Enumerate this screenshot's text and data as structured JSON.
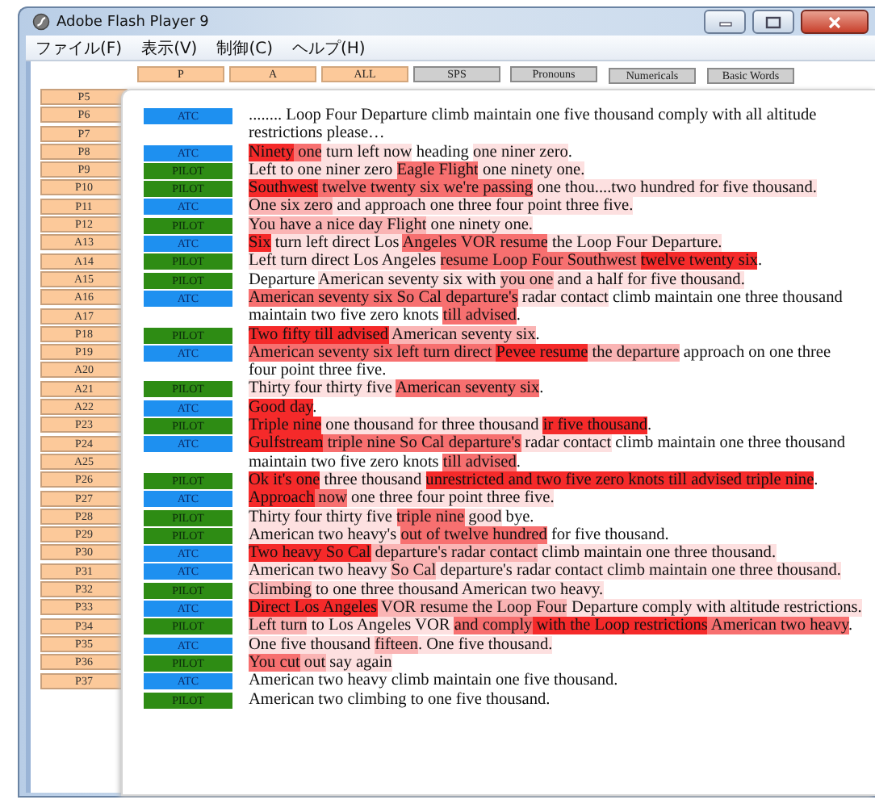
{
  "window": {
    "title": "Adobe Flash Player 9"
  },
  "menu": [
    "ファイル(F)",
    "表示(V)",
    "制御(C)",
    "ヘルプ(H)"
  ],
  "filters": [
    {
      "label": "P",
      "kind": "speaker"
    },
    {
      "label": "A",
      "kind": "speaker"
    },
    {
      "label": "ALL",
      "kind": "speaker"
    },
    {
      "label": "SPS",
      "kind": "category"
    },
    {
      "label": "Pronouns",
      "kind": "category"
    },
    {
      "label": "Numericals",
      "kind": "category"
    },
    {
      "label": "Basic Words",
      "kind": "category"
    }
  ],
  "turns": [
    "P5",
    "P6",
    "P7",
    "P8",
    "P9",
    "P10",
    "P11",
    "P12",
    "A13",
    "A14",
    "A15",
    "A16",
    "A17",
    "P18",
    "P19",
    "A20",
    "A21",
    "A22",
    "P23",
    "P24",
    "A25",
    "P26",
    "P27",
    "P28",
    "P29",
    "P30",
    "P31",
    "P32",
    "P33",
    "P34",
    "P35",
    "P36",
    "P37"
  ],
  "transcript": [
    {
      "speaker": "ATC",
      "kind": "atc",
      "segments": [
        {
          "text": "........ Loop Four Departure climb maintain one five thousand comply with all altitude restrictions please…"
        }
      ]
    },
    {
      "speaker": "ATC",
      "kind": "atc",
      "segments": [
        {
          "text": "Ninety",
          "color": "#f52a2a"
        },
        {
          "text": " one",
          "color": "#f77070"
        },
        {
          "text": " turn left now",
          "color": "#fde0e0"
        },
        {
          "text": " heading "
        },
        {
          "text": "one niner zero",
          "color": "#fde0e0"
        },
        {
          "text": "."
        }
      ]
    },
    {
      "speaker": "PILOT",
      "kind": "pilot",
      "segments": [
        {
          "text": "Left to one niner zero ",
          "color": "#fde0e0"
        },
        {
          "text": "Eagle Flight",
          "color": "#f77070"
        },
        {
          "text": " one ninety one.",
          "color": "#fde0e0"
        }
      ]
    },
    {
      "speaker": "PILOT",
      "kind": "pilot",
      "segments": [
        {
          "text": "Southwest",
          "color": "#f52a2a"
        },
        {
          "text": " twelve twenty six we're passing",
          "color": "#f77070"
        },
        {
          "text": " one thou....two hundred for five thousand.",
          "color": "#fde0e0"
        }
      ]
    },
    {
      "speaker": "ATC",
      "kind": "atc",
      "segments": [
        {
          "text": "One six zero",
          "color": "#fab4b4"
        },
        {
          "text": " and approach one three four point three five.",
          "color": "#fde0e0"
        }
      ]
    },
    {
      "speaker": "PILOT",
      "kind": "pilot",
      "segments": [
        {
          "text": "You have a nice day Flight",
          "color": "#fab4b4"
        },
        {
          "text": " one ninety one.",
          "color": "#fde0e0"
        }
      ]
    },
    {
      "speaker": "ATC",
      "kind": "atc",
      "segments": [
        {
          "text": "Six",
          "color": "#f52a2a"
        },
        {
          "text": " turn left direct Los ",
          "color": "#fde0e0"
        },
        {
          "text": "Angeles VOR resume",
          "color": "#f77070"
        },
        {
          "text": " the Loop Four Departure.",
          "color": "#fde0e0"
        }
      ]
    },
    {
      "speaker": "PILOT",
      "kind": "pilot",
      "segments": [
        {
          "text": "Left turn direct Los Angeles ",
          "color": "#fde0e0"
        },
        {
          "text": "resume Loop Four Southwest ",
          "color": "#f77070"
        },
        {
          "text": "twelve twenty six",
          "color": "#f52a2a"
        },
        {
          "text": "."
        }
      ]
    },
    {
      "speaker": "PILOT",
      "kind": "pilot",
      "segments": [
        {
          "text": "Departure "
        },
        {
          "text": "American seventy six with ",
          "color": "#fde0e0"
        },
        {
          "text": "you one",
          "color": "#fab4b4"
        },
        {
          "text": " and a half for five thousand.",
          "color": "#fde0e0"
        }
      ]
    },
    {
      "speaker": "ATC",
      "kind": "atc",
      "segments": [
        {
          "text": "American seventy six So Cal departure's",
          "color": "#f77070"
        },
        {
          "text": " radar contact",
          "color": "#fde0e0"
        },
        {
          "text": " climb maintain one three thousand maintain two five zero knots "
        },
        {
          "text": "till advised",
          "color": "#f77070"
        },
        {
          "text": "."
        }
      ]
    },
    {
      "speaker": "PILOT",
      "kind": "pilot",
      "segments": [
        {
          "text": "Two fifty till advised",
          "color": "#f52a2a"
        },
        {
          "text": " American seventy six",
          "color": "#fab4b4"
        },
        {
          "text": "."
        }
      ]
    },
    {
      "speaker": "ATC",
      "kind": "atc",
      "segments": [
        {
          "text": "American seventy six left turn direct ",
          "color": "#f77070"
        },
        {
          "text": "Pevee resume",
          "color": "#f52a2a"
        },
        {
          "text": " the departure",
          "color": "#fab4b4"
        },
        {
          "text": " approach on one three four point three five."
        }
      ]
    },
    {
      "speaker": "PILOT",
      "kind": "pilot",
      "segments": [
        {
          "text": "Thirty four thirty five ",
          "color": "#fde0e0"
        },
        {
          "text": "American seventy six",
          "color": "#f77070"
        },
        {
          "text": "."
        }
      ]
    },
    {
      "speaker": "ATC",
      "kind": "atc",
      "segments": [
        {
          "text": "Good day",
          "color": "#f52a2a"
        },
        {
          "text": "."
        }
      ]
    },
    {
      "speaker": "PILOT",
      "kind": "pilot",
      "segments": [
        {
          "text": "Triple nine",
          "color": "#f52a2a"
        },
        {
          "text": " one thousand for three thousand ",
          "color": "#fde0e0"
        },
        {
          "text": "ir five thousand",
          "color": "#f52a2a"
        },
        {
          "text": "."
        }
      ]
    },
    {
      "speaker": "ATC",
      "kind": "atc",
      "segments": [
        {
          "text": "Gulfstream",
          "color": "#f52a2a"
        },
        {
          "text": " triple nine So Cal departure's",
          "color": "#f77070"
        },
        {
          "text": " radar contact",
          "color": "#fde0e0"
        },
        {
          "text": " climb maintain one three thousand maintain two five zero knots "
        },
        {
          "text": "till advised",
          "color": "#f77070"
        },
        {
          "text": "."
        }
      ]
    },
    {
      "speaker": "PILOT",
      "kind": "pilot",
      "segments": [
        {
          "text": "Ok it's one",
          "color": "#f52a2a"
        },
        {
          "text": " three thousand ",
          "color": "#fde0e0"
        },
        {
          "text": "unrestricted and two five zero knots till advised triple nine",
          "color": "#f52a2a"
        },
        {
          "text": "."
        }
      ]
    },
    {
      "speaker": "ATC",
      "kind": "atc",
      "segments": [
        {
          "text": "Approach",
          "color": "#f52a2a"
        },
        {
          "text": " now",
          "color": "#f77070"
        },
        {
          "text": " one three four point three five.",
          "color": "#fde0e0"
        }
      ]
    },
    {
      "speaker": "PILOT",
      "kind": "pilot",
      "segments": [
        {
          "text": "Thirty four thirty five ",
          "color": "#fde0e0"
        },
        {
          "text": "triple nine",
          "color": "#f77070"
        },
        {
          "text": " good",
          "color": "#fde0e0"
        },
        {
          "text": " bye."
        }
      ]
    },
    {
      "speaker": "PILOT",
      "kind": "pilot",
      "segments": [
        {
          "text": "American two heavy's ",
          "color": "#fde0e0"
        },
        {
          "text": "out of twelve hundred",
          "color": "#f77070"
        },
        {
          "text": " for five thousand."
        }
      ]
    },
    {
      "speaker": "ATC",
      "kind": "atc",
      "segments": [
        {
          "text": "Two heavy So Cal",
          "color": "#f52a2a"
        },
        {
          "text": " departure's radar contact",
          "color": "#fab4b4"
        },
        {
          "text": " climb maintain one three thousand.",
          "color": "#fde0e0"
        }
      ]
    },
    {
      "speaker": "ATC",
      "kind": "atc",
      "segments": [
        {
          "text": "American two heavy ",
          "color": "#fde0e0"
        },
        {
          "text": "So Cal",
          "color": "#fab4b4"
        },
        {
          "text": " departure's radar contact climb maintain one three thousand.",
          "color": "#fde0e0"
        }
      ]
    },
    {
      "speaker": "PILOT",
      "kind": "pilot",
      "segments": [
        {
          "text": "Climbing",
          "color": "#fab4b4"
        },
        {
          "text": " to one three thousand American two heavy.",
          "color": "#fde0e0"
        }
      ]
    },
    {
      "speaker": "ATC",
      "kind": "atc",
      "segments": [
        {
          "text": "Direct Los Angeles",
          "color": "#f52a2a"
        },
        {
          "text": " VOR resume the Loop Four",
          "color": "#fab4b4"
        },
        {
          "text": " Departure comply with altitude restrictions.",
          "color": "#fde0e0"
        }
      ]
    },
    {
      "speaker": "PILOT",
      "kind": "pilot",
      "segments": [
        {
          "text": "Left turn",
          "color": "#fab4b4"
        },
        {
          "text": " to Los Angeles VOR ",
          "color": "#fde0e0"
        },
        {
          "text": "and comply",
          "color": "#f77070"
        },
        {
          "text": " with the Loop restrictions",
          "color": "#f52a2a"
        },
        {
          "text": " American two heavy",
          "color": "#f77070"
        },
        {
          "text": "."
        }
      ]
    },
    {
      "speaker": "ATC",
      "kind": "atc",
      "segments": [
        {
          "text": "One five thousand ",
          "color": "#fde0e0"
        },
        {
          "text": "fifteen",
          "color": "#fab4b4"
        },
        {
          "text": ". One five thousand.",
          "color": "#fde0e0"
        }
      ]
    },
    {
      "speaker": "PILOT",
      "kind": "pilot",
      "segments": [
        {
          "text": "You cut",
          "color": "#f77070"
        },
        {
          "text": " out",
          "color": "#fab4b4"
        },
        {
          "text": " say again",
          "color": "#fde0e0"
        }
      ]
    },
    {
      "speaker": "ATC",
      "kind": "atc",
      "segments": [
        {
          "text": "American two heavy climb maintain one five thousand."
        }
      ]
    },
    {
      "speaker": "PILOT",
      "kind": "pilot",
      "segments": [
        {
          "text": "American two climbing to one five thousand."
        }
      ]
    }
  ]
}
